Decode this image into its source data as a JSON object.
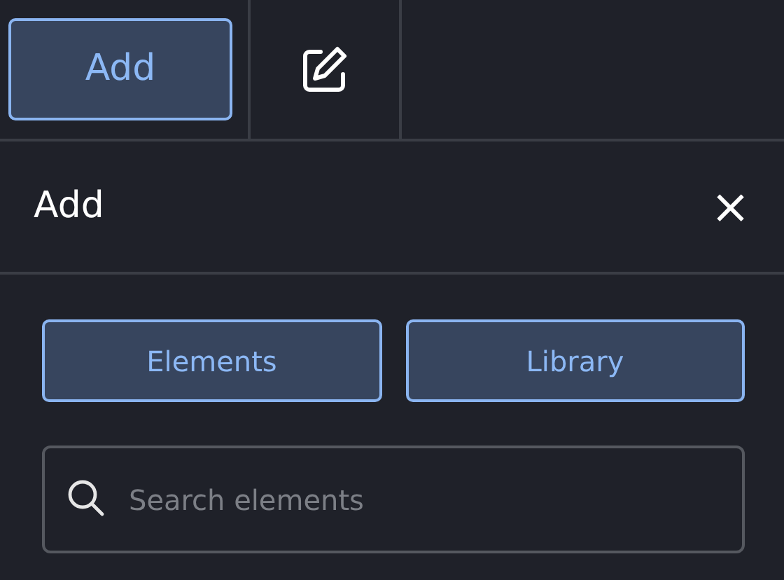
{
  "toolbar": [
    {
      "kind": "text",
      "label": "Add",
      "selected": true
    },
    {
      "kind": "edit",
      "selected": false
    }
  ],
  "panel": {
    "title": "Add",
    "close": "×"
  },
  "tabs": [
    {
      "label": "Elements"
    },
    {
      "label": "Library"
    }
  ],
  "search": {
    "placeholder": "Search elements"
  }
}
